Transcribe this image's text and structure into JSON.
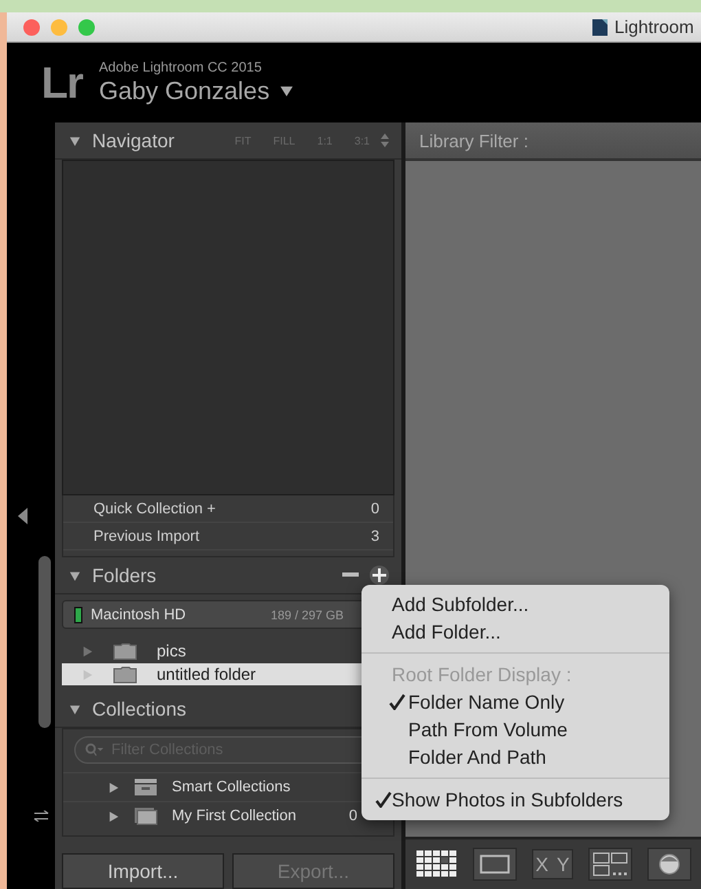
{
  "window": {
    "title": "Lightroom"
  },
  "header": {
    "logo": "Lr",
    "product": "Adobe Lightroom CC 2015",
    "user": "Gaby Gonzales"
  },
  "navigator": {
    "title": "Navigator",
    "expanded": true,
    "zoom_options": [
      "FIT",
      "FILL",
      "1:1",
      "3:1"
    ]
  },
  "catalog": [
    {
      "name": "Quick Collection +",
      "count": "0"
    },
    {
      "name": "Previous Import",
      "count": "3"
    }
  ],
  "folders": {
    "title": "Folders",
    "expanded": true,
    "volume": {
      "name": "Macintosh HD",
      "usage": "189 / 297 GB"
    },
    "items": [
      {
        "name": "pics",
        "selected": false
      },
      {
        "name": "untitled folder",
        "selected": true
      }
    ]
  },
  "collections": {
    "title": "Collections",
    "expanded": true,
    "filter": {
      "placeholder": "Filter Collections"
    },
    "items": [
      {
        "name": "Smart Collections",
        "kind": "set"
      },
      {
        "name": "My First Collection",
        "kind": "collection",
        "count": "0"
      }
    ]
  },
  "buttons": [
    "Import...",
    "Export..."
  ],
  "library_filter": {
    "label": "Library Filter :"
  },
  "toolbar": [
    {
      "kind": "grid"
    },
    {
      "kind": "loupe"
    },
    {
      "kind": "compare",
      "label": "XY"
    },
    {
      "kind": "survey"
    },
    {
      "kind": "people"
    }
  ],
  "menu": {
    "items": [
      {
        "kind": "command",
        "label": "Add Subfolder..."
      },
      {
        "kind": "command",
        "label": "Add Folder..."
      },
      {
        "kind": "separator"
      },
      {
        "kind": "heading",
        "label": "Root Folder Display :"
      },
      {
        "kind": "option",
        "label": "Folder Name Only",
        "checked": true
      },
      {
        "kind": "option",
        "label": "Path From Volume",
        "checked": false
      },
      {
        "kind": "option",
        "label": "Folder And Path",
        "checked": false
      },
      {
        "kind": "separator"
      },
      {
        "kind": "toggle",
        "label": "Show Photos in Subfolders",
        "checked": true
      }
    ]
  }
}
